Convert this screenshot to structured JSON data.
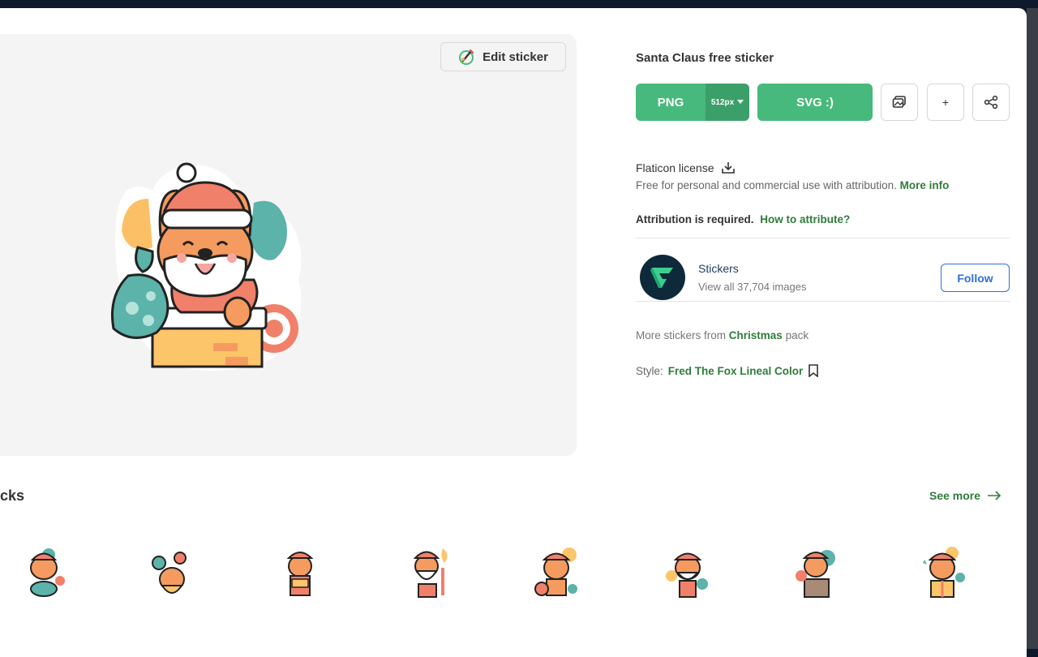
{
  "preview": {
    "edit_label": "Edit sticker"
  },
  "details": {
    "title": "Santa Claus free sticker",
    "png_label": "PNG",
    "png_size": "512px",
    "svg_label": "SVG :)"
  },
  "license": {
    "title": "Flaticon license",
    "desc": "Free for personal and commercial use with attribution.",
    "more_info": "More info",
    "attr_text": "Attribution is required.",
    "attr_link": "How to attribute?"
  },
  "author": {
    "name": "Stickers",
    "sub": "View all 37,704 images",
    "follow": "Follow"
  },
  "pack": {
    "prefix": "More stickers from",
    "name": "Christmas",
    "suffix": "pack"
  },
  "style": {
    "label": "Style:",
    "name": "Fred The Fox Lineal Color"
  },
  "related": {
    "title": "cks",
    "see_more": "See more"
  },
  "colors": {
    "green": "#48b97c",
    "green_dark": "#3b9f69",
    "link_green": "#2f7d3b",
    "follow_blue": "#2f6fd6"
  }
}
